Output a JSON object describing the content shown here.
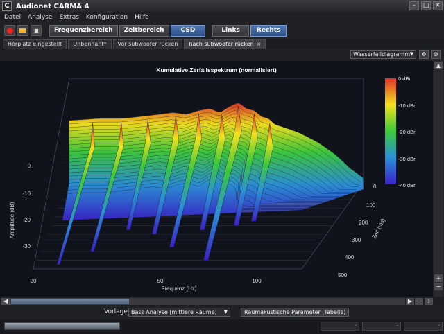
{
  "window": {
    "title": "Audionet CARMA 4",
    "app_icon": "C"
  },
  "menu": [
    "Datei",
    "Analyse",
    "Extras",
    "Konfiguration",
    "Hilfe"
  ],
  "toolbar": {
    "buttons": [
      "Frequenzbereich",
      "Zeitbereich",
      "CSD"
    ],
    "active": "CSD",
    "channels": [
      "Links",
      "Rechts"
    ],
    "active_channel": "Rechts"
  },
  "tabs": [
    {
      "label": "Hörplatz eingestellt"
    },
    {
      "label": "Unbennant*"
    },
    {
      "label": "Vor subwoofer rücken"
    },
    {
      "label": "nach subwoofer rücken",
      "close": "×"
    }
  ],
  "view": {
    "selected": "Wasserfalldiagramm"
  },
  "chart_data": {
    "type": "waterfall",
    "title": "Kumulative Zerfallsspektrum (normalisiert)",
    "xlabel": "Frequenz (Hz)",
    "ylabel": "Amplitude (dB)",
    "zlabel": "Zeit (ms)",
    "x_ticks": [
      "20",
      "50",
      "100"
    ],
    "y_ticks": [
      "0",
      "-10",
      "-20",
      "-30"
    ],
    "z_ticks": [
      "0",
      "100",
      "200",
      "300",
      "400",
      "500"
    ],
    "colorbar": {
      "labels": [
        "0 dBr",
        "-10 dBr",
        "-20 dBr",
        "-30 dBr",
        "-40 dBr"
      ],
      "colors": [
        "#e0302a",
        "#f2e21c",
        "#3cc93c",
        "#2b8fd8",
        "#3a22c8"
      ]
    },
    "front_profile": [
      [
        20,
        -9
      ],
      [
        25,
        -8
      ],
      [
        30,
        -8
      ],
      [
        35,
        -7
      ],
      [
        40,
        -6
      ],
      [
        45,
        -5
      ],
      [
        50,
        -6
      ],
      [
        55,
        -4
      ],
      [
        60,
        -3
      ],
      [
        65,
        -5
      ],
      [
        70,
        -2
      ],
      [
        75,
        0
      ],
      [
        80,
        -3
      ],
      [
        85,
        -4
      ],
      [
        90,
        -7
      ],
      [
        95,
        -8
      ],
      [
        100,
        -11
      ],
      [
        120,
        -15
      ],
      [
        140,
        -20
      ],
      [
        160,
        -26
      ],
      [
        180,
        -33
      ],
      [
        200,
        -38
      ]
    ]
  },
  "bottom": {
    "vorlagen_label": "Vorlagen",
    "vorlagen_value": "Bass Analyse (mittlere Räume)",
    "raum_button": "Raumakustische Parameter (Tabelle)"
  },
  "status": {
    "progress": 1.0,
    "fields": [
      "-",
      "-",
      "-"
    ]
  }
}
